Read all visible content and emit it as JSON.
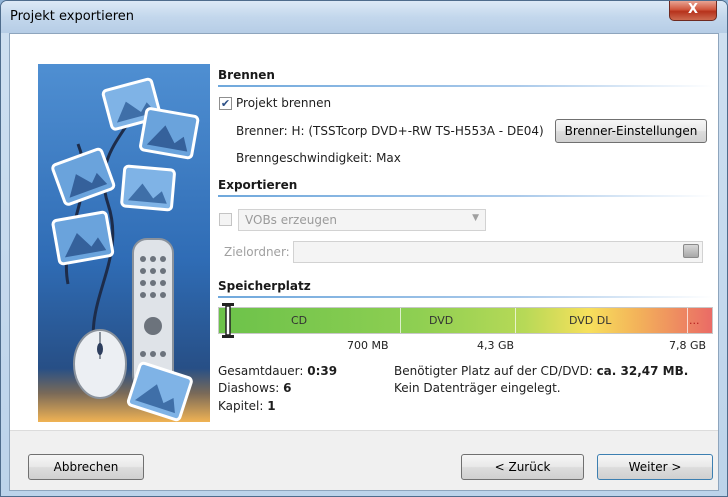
{
  "window": {
    "title": "Projekt exportieren",
    "close_label": "X"
  },
  "brennen": {
    "section_title": "Brennen",
    "checkbox_label": "Projekt brennen",
    "checked": true,
    "burner_text": "Brenner: H: (TSSTcorp DVD+-RW TS-H553A - DE04)",
    "speed_text": "Brenngeschwindigkeit: Max",
    "settings_button": "Brenner-Einstellungen"
  },
  "exportieren": {
    "section_title": "Exportieren",
    "checked": false,
    "combo_value": "VOBs erzeugen",
    "folder_label": "Zielordner:",
    "folder_value": ""
  },
  "speicherplatz": {
    "section_title": "Speicherplatz",
    "bar_labels": [
      "CD",
      "DVD",
      "DVD DL",
      "..."
    ],
    "tick_labels": [
      "700 MB",
      "4,3 GB",
      "7,8 GB"
    ],
    "gesamtdauer_label": "Gesamtdauer:",
    "gesamtdauer_value": "0:39",
    "diashows_label": "Diashows:",
    "diashows_value": "6",
    "kapitel_label": "Kapitel:",
    "kapitel_value": "1",
    "needed_label": "Benötigter Platz auf der CD/DVD:",
    "needed_value": "ca. 32,47 MB.",
    "disc_status": "Kein Datenträger eingelegt.",
    "usage_fraction": 0.004
  },
  "footer": {
    "cancel": "Abbrechen",
    "back": "< Zurück",
    "next": "Weiter >"
  },
  "colors": {
    "accent": "#6fa8dc",
    "cd": "#6cc24a",
    "dvd": "#b7d957",
    "dvd_dl": "#f3b25a",
    "overflow": "#ea6b66"
  }
}
